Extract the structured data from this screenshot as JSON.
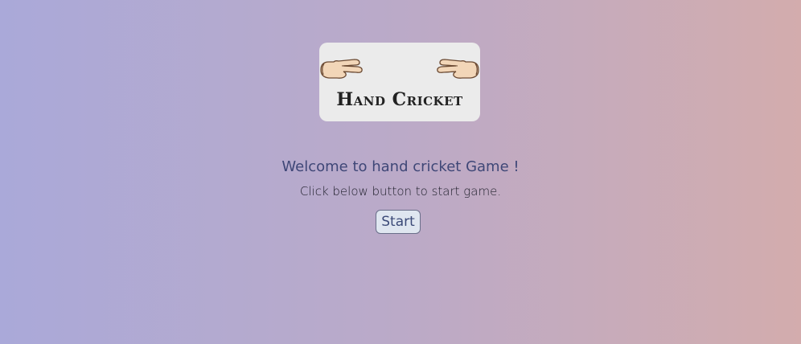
{
  "logo": {
    "title": "Hand Cricket",
    "left_icon": "hand-two-fingers-icon",
    "right_icon": "hand-two-fingers-icon"
  },
  "welcome": {
    "heading": "Welcome to hand cricket Game !",
    "instruction": "Click below button to start game."
  },
  "actions": {
    "start_label": "Start"
  },
  "colors": {
    "background_left": "#aaa9d9",
    "background_right": "#d3acad",
    "card": "#ebebeb",
    "heading": "#3f4777",
    "button_bg": "#dfe6f0"
  }
}
